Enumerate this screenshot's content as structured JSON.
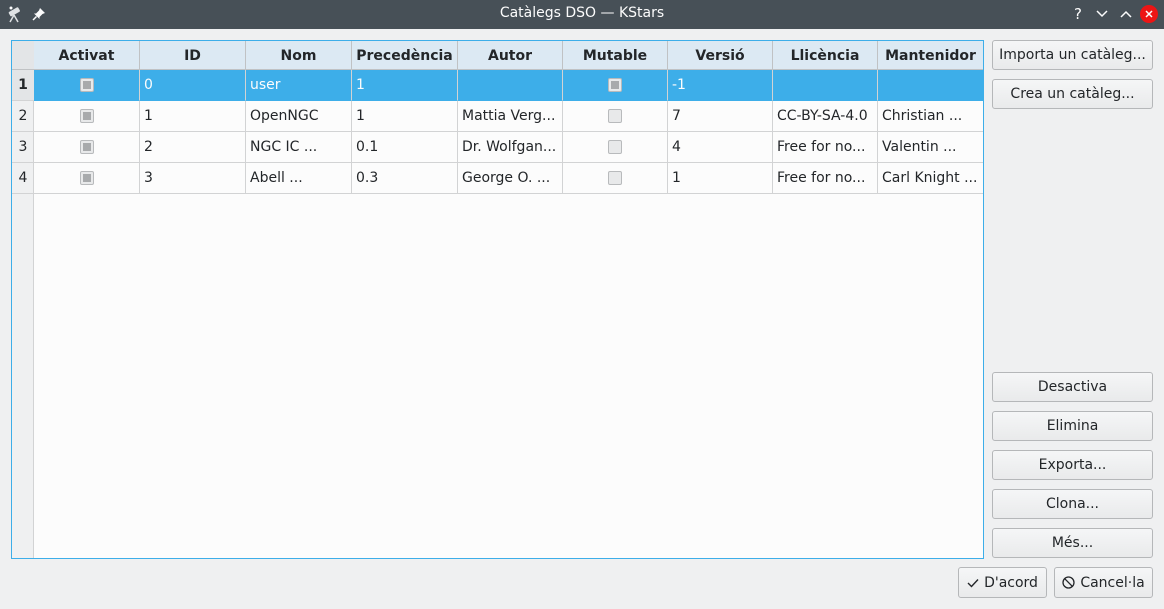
{
  "window": {
    "title": "Catàlegs DSO — KStars",
    "help_glyph": "?"
  },
  "table": {
    "columns": [
      "Activat",
      "ID",
      "Nom",
      "Precedència",
      "Autor",
      "Mutable",
      "Versió",
      "Llicència",
      "Mantenidor"
    ],
    "row_numbers": [
      "1",
      "2",
      "3",
      "4"
    ],
    "rows": [
      {
        "activat": true,
        "id": "0",
        "nom": "user",
        "precedencia": "1",
        "autor": "",
        "mutable": true,
        "versio": "-1",
        "llicencia": "",
        "mantenidor": ""
      },
      {
        "activat": true,
        "id": "1",
        "nom": "OpenNGC",
        "precedencia": "1",
        "autor": "Mattia Verg...",
        "mutable": false,
        "versio": "7",
        "llicencia": "CC-BY-SA-4.0",
        "mantenidor": "Christian ..."
      },
      {
        "activat": true,
        "id": "2",
        "nom": "NGC IC ...",
        "precedencia": "0.1",
        "autor": "Dr. Wolfgan...",
        "mutable": false,
        "versio": "4",
        "llicencia": "Free for no...",
        "mantenidor": "Valentin ..."
      },
      {
        "activat": true,
        "id": "3",
        "nom": "Abell ...",
        "precedencia": "0.3",
        "autor": "George O. ...",
        "mutable": false,
        "versio": "1",
        "llicencia": "Free for no...",
        "mantenidor": "Carl Knight ..."
      }
    ]
  },
  "side_buttons": {
    "import": "Importa un catàleg...",
    "create": "Crea un catàleg...",
    "disable": "Desactiva",
    "remove": "Elimina",
    "export": "Exporta...",
    "clone": "Clona...",
    "more": "Més..."
  },
  "dialog_buttons": {
    "ok": "D'acord",
    "cancel": "Cancel·la"
  },
  "colors": {
    "titlebar": "#475057",
    "selection": "#3daee9",
    "header": "#dce9f3",
    "close": "#ed1515"
  }
}
